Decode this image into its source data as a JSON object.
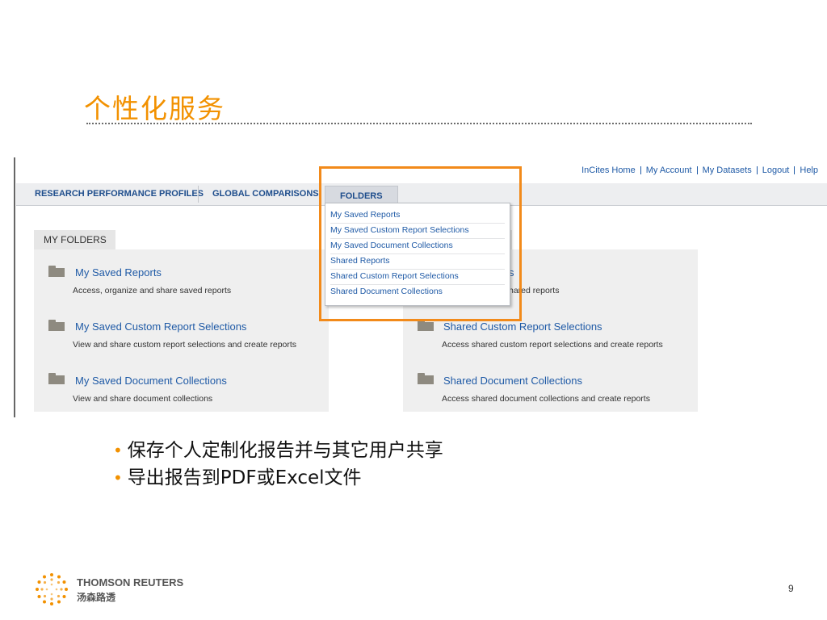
{
  "slide": {
    "title": "个性化服务",
    "page_number": "9"
  },
  "top_links": [
    "InCites Home",
    "My Account",
    "My Datasets",
    "Logout",
    "Help"
  ],
  "nav": {
    "tabs": [
      {
        "label": "RESEARCH PERFORMANCE PROFILES"
      },
      {
        "label": "GLOBAL COMPARISONS"
      },
      {
        "label": "FOLDERS"
      }
    ]
  },
  "my_folders": {
    "tab_label": "MY FOLDERS",
    "left_items": [
      {
        "title": "My Saved Reports",
        "desc": "Access, organize and share saved reports"
      },
      {
        "title": "My Saved Custom Report Selections",
        "desc": "View and share custom report selections and create reports"
      },
      {
        "title": "My Saved Document Collections",
        "desc": "View and share document collections"
      }
    ],
    "right_items": [
      {
        "title": "s",
        "desc": "hared reports"
      },
      {
        "title": "Shared Custom Report Selections",
        "desc": "Access shared custom report selections and create reports"
      },
      {
        "title": "Shared Document Collections",
        "desc": "Access shared document collections and create reports"
      }
    ]
  },
  "dropdown": {
    "items": [
      "My Saved Reports",
      "My Saved Custom Report Selections",
      "My Saved Document Collections",
      "Shared Reports",
      "Shared Custom Report Selections",
      "Shared Document Collections"
    ]
  },
  "bullets": [
    "保存个人定制化报告并与其它用户共享",
    "导出报告到PDF或Excel文件"
  ],
  "footer": {
    "brand_en": "THOMSON REUTERS",
    "brand_cn": "汤森路透"
  },
  "colors": {
    "title_orange": "#f29100",
    "highlight_orange": "#f28a1a",
    "link_blue": "#1f5aa6",
    "nav_blue": "#1e4d8c"
  },
  "icons": [
    "folder-icon",
    "thomson-reuters-logo-icon"
  ]
}
